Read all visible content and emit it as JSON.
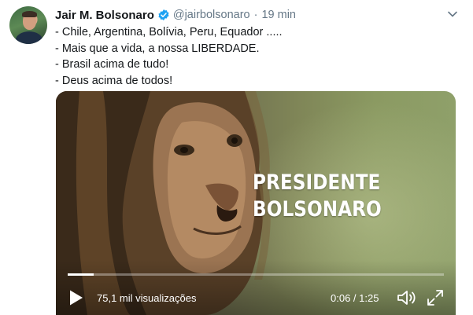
{
  "tweet": {
    "author_name": "Jair M. Bolsonaro",
    "handle": "@jairbolsonaro",
    "separator": "·",
    "time": "19 min",
    "lines": [
      "- Chile, Argentina, Bolívia, Peru, Equador .....",
      "- Mais que a vida, a nossa LIBERDADE.",
      "- Brasil acima de tudo!",
      "- Deus acima de todos!"
    ]
  },
  "video": {
    "overlay_line1": "PRESIDENTE",
    "overlay_line2": "BOLSONARO",
    "views": "75,1 mil visualizações",
    "duration": "0:06 / 1:25",
    "progress": 0.07
  },
  "colors": {
    "verified": "#1da1f2",
    "secondary_text": "#657786"
  },
  "icons": [
    "verified-badge-icon",
    "chevron-down-icon",
    "play-icon",
    "volume-icon",
    "fullscreen-icon"
  ]
}
